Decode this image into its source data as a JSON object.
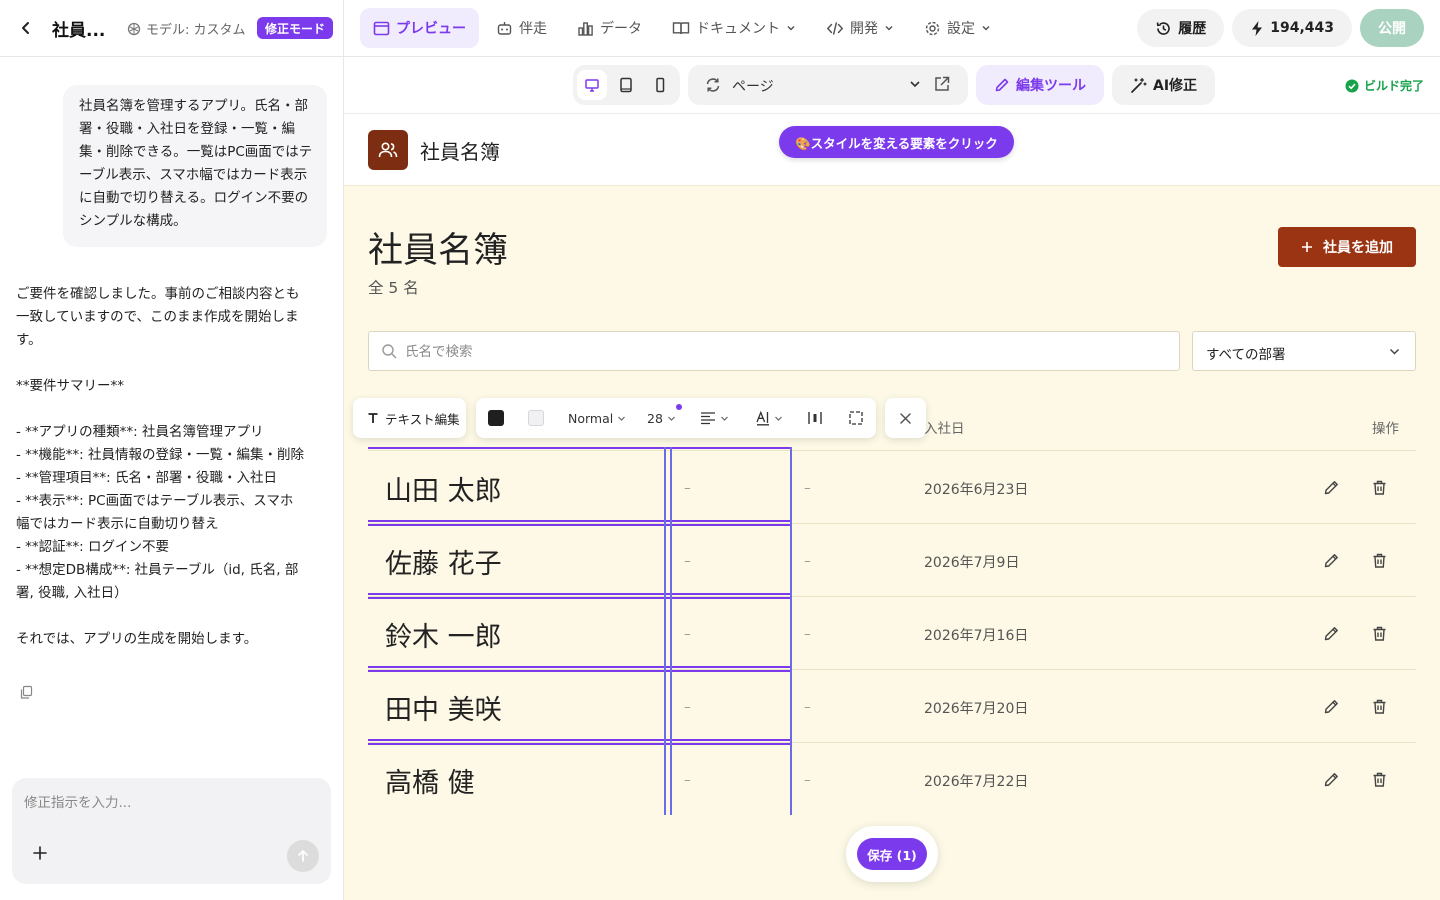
{
  "topbar": {
    "app_name": "社員...",
    "model_label": "モデル: カスタム",
    "mode_badge": "修正モード",
    "nav": [
      {
        "label": "プレビュー"
      },
      {
        "label": "伴走"
      },
      {
        "label": "データ"
      },
      {
        "label": "ドキュメント"
      },
      {
        "label": "開発"
      },
      {
        "label": "設定"
      }
    ],
    "history_label": "履歴",
    "credits": "194,443",
    "publish_label": "公開"
  },
  "chat": {
    "user_message": "社員名簿を管理するアプリ。氏名・部署・役職・入社日を登録・一覧・編集・削除できる。一覧はPC画面ではテーブル表示、スマホ幅ではカード表示に自動で切り替える。ログイン不要のシンプルな構成。",
    "assistant_message": "ご要件を確認しました。事前のご相談内容とも一致していますので、このまま作成を開始します。\n\n**要件サマリー**\n\n- **アプリの種類**: 社員名簿管理アプリ\n- **機能**: 社員情報の登録・一覧・編集・削除\n- **管理項目**: 氏名・部署・役職・入社日\n- **表示**: PC画面ではテーブル表示、スマホ幅ではカード表示に自動切り替え\n- **認証**: ログイン不要\n- **想定DB構成**: 社員テーブル（id, 氏名, 部署, 役職, 入社日）\n\nそれでは、アプリの生成を開始します。",
    "input_placeholder": "修正指示を入力..."
  },
  "preview_toolbar": {
    "page_label": "ページ",
    "edit_tools_label": "編集ツール",
    "ai_fix_label": "AI修正",
    "build_status": "ビルド完了"
  },
  "app": {
    "header_title": "社員名簿",
    "click_hint": "🎨スタイルを変える要素をクリック",
    "page_title": "社員名簿",
    "count_text": "全 5 名",
    "add_button": "社員を追加",
    "search_placeholder": "氏名で検索",
    "dept_filter": "すべての部署",
    "columns": {
      "hire_date": "入社日",
      "actions": "操作"
    },
    "rows": [
      {
        "name": "山田 太郎",
        "dept": "–",
        "role": "–",
        "hire_date": "2026年6月23日"
      },
      {
        "name": "佐藤 花子",
        "dept": "–",
        "role": "–",
        "hire_date": "2026年7月9日"
      },
      {
        "name": "鈴木 一郎",
        "dept": "–",
        "role": "–",
        "hire_date": "2026年7月16日"
      },
      {
        "name": "田中 美咲",
        "dept": "–",
        "role": "–",
        "hire_date": "2026年7月20日"
      },
      {
        "name": "高橋 健",
        "dept": "–",
        "role": "–",
        "hire_date": "2026年7月22日"
      }
    ]
  },
  "text_toolbar": {
    "text_edit_label": "テキスト編集",
    "text_color": "#1f1f1f",
    "bg_color": "#f1f1f4",
    "style_value": "Normal",
    "size_value": "28",
    "font_label": "A|"
  },
  "save_button": "保存 (1)",
  "colors": {
    "accent": "#7c3aed",
    "brand": "#9a3412",
    "logo": "#7c2d12",
    "preview_bg": "#fdf9e6",
    "success": "#16a34a"
  }
}
